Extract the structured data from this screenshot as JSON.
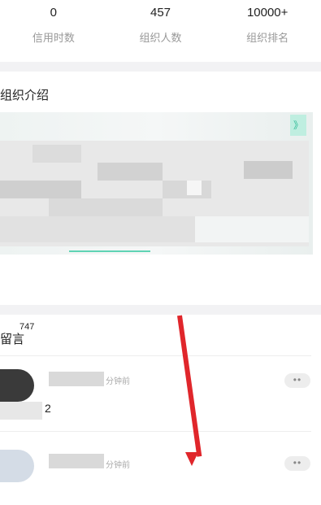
{
  "stats": [
    {
      "value": "0",
      "label": "信用时数"
    },
    {
      "value": "457",
      "label": "组织人数"
    },
    {
      "value": "10000+",
      "label": "组织排名"
    }
  ],
  "intro": {
    "title": "组织介绍",
    "tag": "》"
  },
  "comments": {
    "title": "留言",
    "count": "747",
    "items": [
      {
        "time": "分钟前",
        "text": "2",
        "more": "••"
      },
      {
        "time": "分钟前",
        "text": "",
        "more": "••"
      }
    ]
  },
  "colors": {
    "accent": "#2dbb95",
    "arrow": "#e0262b",
    "divider_bg": "#f2f2f4"
  }
}
